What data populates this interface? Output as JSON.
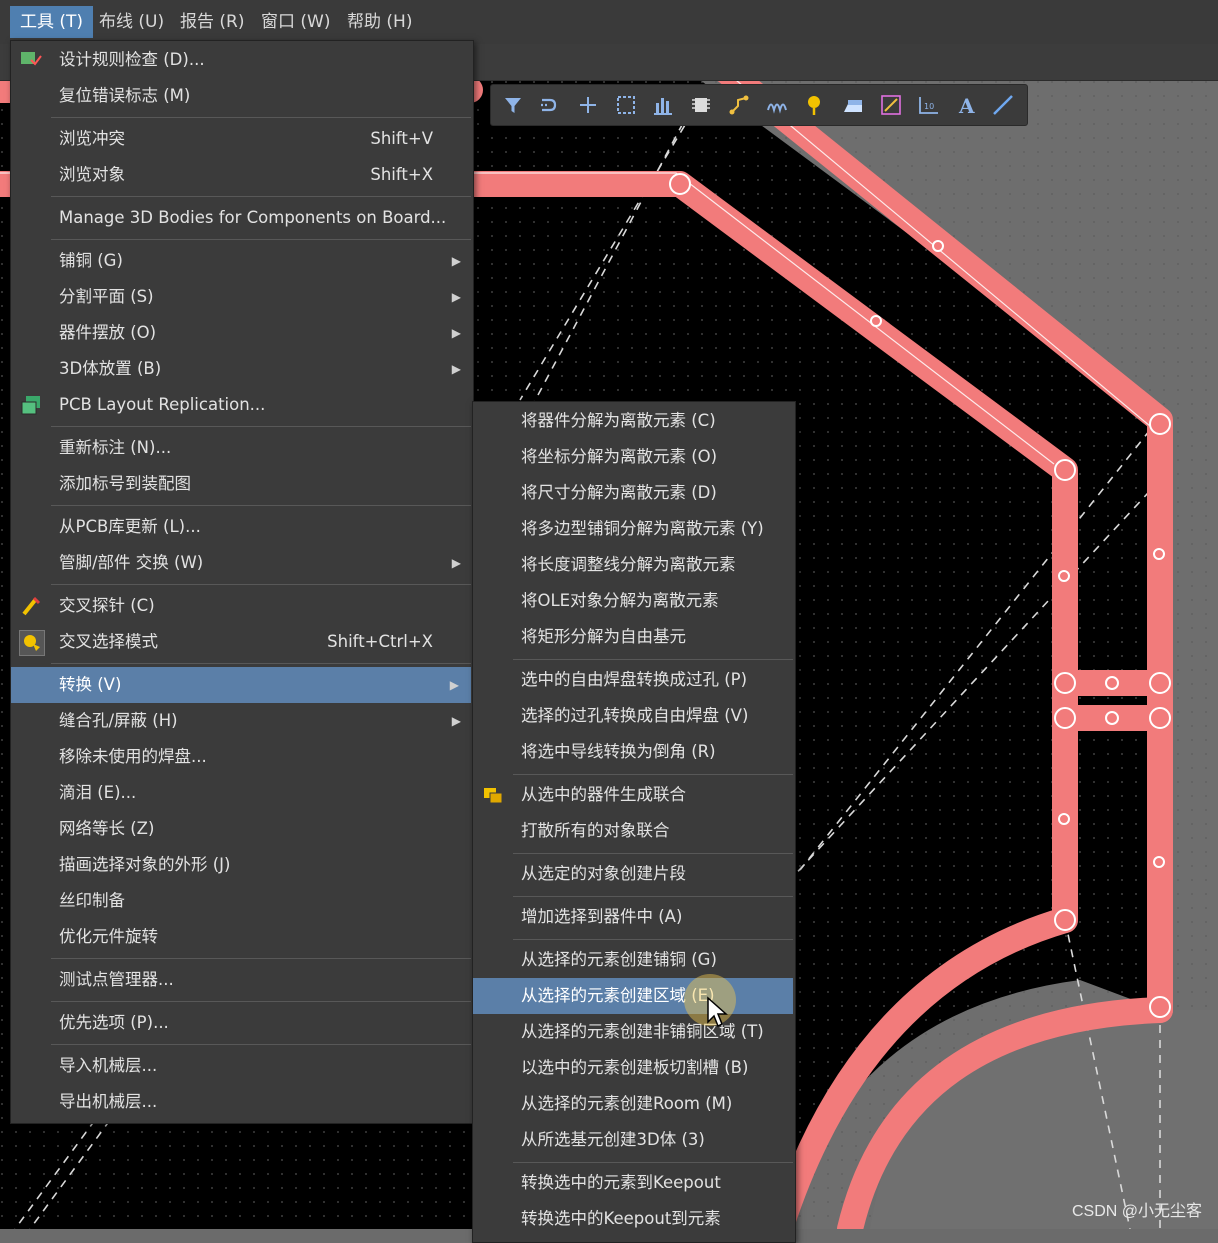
{
  "menubar": {
    "items": [
      {
        "label": "工具 (T)",
        "active": true
      },
      {
        "label": "布线 (U)"
      },
      {
        "label": "报告 (R)"
      },
      {
        "label": "窗口 (W)"
      },
      {
        "label": "帮助 (H)"
      }
    ]
  },
  "tools_menu": {
    "items": [
      {
        "label": "设计规则检查 (D)...",
        "icon": "drc-icon"
      },
      {
        "label": "复位错误标志 (M)"
      },
      {
        "label": "浏览冲突",
        "shortcut": "Shift+V"
      },
      {
        "label": "浏览对象",
        "shortcut": "Shift+X"
      },
      {
        "label": "Manage 3D Bodies for Components on Board..."
      },
      {
        "label": "铺铜 (G)"
      },
      {
        "label": "分割平面 (S)"
      },
      {
        "label": "器件摆放 (O)"
      },
      {
        "label": "3D体放置 (B)"
      },
      {
        "label": "PCB Layout Replication...",
        "icon": "replication-icon"
      },
      {
        "label": "重新标注 (N)..."
      },
      {
        "label": "添加标号到装配图"
      },
      {
        "label": "从PCB库更新 (L)..."
      },
      {
        "label": "管脚/部件 交换 (W)"
      },
      {
        "label": "交叉探针 (C)",
        "icon": "cross-probe-icon"
      },
      {
        "label": "交叉选择模式",
        "shortcut": "Shift+Ctrl+X",
        "icon": "cross-select-icon"
      },
      {
        "label": "转换 (V)"
      },
      {
        "label": "缝合孔/屏蔽 (H)"
      },
      {
        "label": "移除未使用的焊盘..."
      },
      {
        "label": "滴泪 (E)..."
      },
      {
        "label": "网络等长 (Z)"
      },
      {
        "label": "描画选择对象的外形 (J)"
      },
      {
        "label": "丝印制备"
      },
      {
        "label": "优化元件旋转"
      },
      {
        "label": "测试点管理器..."
      },
      {
        "label": "优先选项 (P)..."
      },
      {
        "label": "导入机械层..."
      },
      {
        "label": "导出机械层..."
      }
    ]
  },
  "convert_submenu": {
    "items": [
      {
        "label": "将器件分解为离散元素 (C)"
      },
      {
        "label": "将坐标分解为离散元素 (O)"
      },
      {
        "label": "将尺寸分解为离散元素 (D)"
      },
      {
        "label": "将多边型铺铜分解为离散元素 (Y)"
      },
      {
        "label": "将长度调整线分解为离散元素"
      },
      {
        "label": "将OLE对象分解为离散元素"
      },
      {
        "label": "将矩形分解为自由基元"
      },
      {
        "label": "选中的自由焊盘转换成过孔 (P)"
      },
      {
        "label": "选择的过孔转换成自由焊盘 (V)"
      },
      {
        "label": "将选中导线转换为倒角 (R)"
      },
      {
        "label": "从选中的器件生成联合",
        "icon": "union-icon"
      },
      {
        "label": "打散所有的对象联合"
      },
      {
        "label": "从选定的对象创建片段"
      },
      {
        "label": "增加选择到器件中 (A)"
      },
      {
        "label": "从选择的元素创建铺铜 (G)"
      },
      {
        "label": "从选择的元素创建区域 (E)"
      },
      {
        "label": "从选择的元素创建非铺铜区域 (T)"
      },
      {
        "label": "以选中的元素创建板切割槽 (B)"
      },
      {
        "label": "从选择的元素创建Room (M)"
      },
      {
        "label": "从所选基元创建3D体 (3)"
      },
      {
        "label": "转换选中的元素到Keepout"
      },
      {
        "label": "转换选中的Keepout到元素"
      }
    ]
  },
  "toolbar": {
    "icons": [
      "filter-icon",
      "route-icon",
      "cross-icon",
      "select-rect-icon",
      "chart-icon",
      "component-icon",
      "interactive-route-icon",
      "diff-pair-icon",
      "pin-icon",
      "area-icon",
      "trace-icon",
      "dimension-icon",
      "text-icon",
      "line-icon"
    ]
  },
  "watermark": "CSDN @小无尘客",
  "colors": {
    "menu_bg": "#3b3b3b",
    "menubar_active": "#4f7fb0",
    "selected_item": "#5b7fa8",
    "trace": "#f27b7b",
    "board": "#000000",
    "canvas": "#6e6e6e"
  }
}
